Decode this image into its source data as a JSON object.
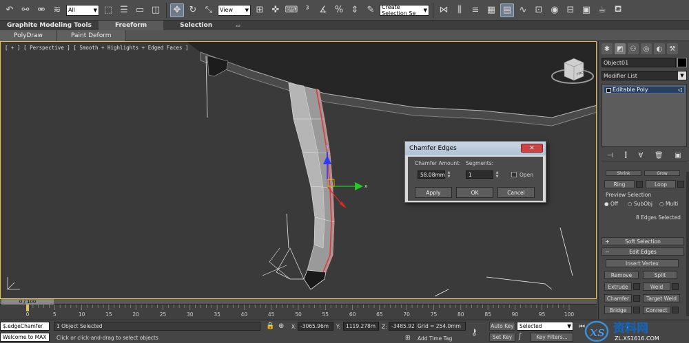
{
  "toolbar": {
    "selection_filter": "All",
    "reference_coord": "View",
    "named_selection_placeholder": "Create Selection Se"
  },
  "ribbon": {
    "tabs": [
      {
        "label": "Graphite Modeling Tools"
      },
      {
        "label": "Freeform"
      },
      {
        "label": "Selection"
      }
    ],
    "panels": [
      {
        "label": "PolyDraw"
      },
      {
        "label": "Paint Deform"
      }
    ]
  },
  "viewport": {
    "label": "[ + ] [ Perspective ] [ Smooth + Highlights + Edged Faces ]",
    "viewcube_label": "FRONT"
  },
  "dialog": {
    "title": "Chamfer Edges",
    "close_label": "✕",
    "chamfer_amount_label": "Chamfer Amount:",
    "chamfer_amount_value": "58.08mm",
    "segments_label": "Segments:",
    "segments_value": "1",
    "open_label": "Open",
    "apply_label": "Apply",
    "ok_label": "OK",
    "cancel_label": "Cancel"
  },
  "command_panel": {
    "object_name": "Object01",
    "modifier_list_label": "Modifier List",
    "stack_item": "Editable Poly",
    "shrink_label": "Shrink",
    "grow_label": "Grow",
    "ring_label": "Ring",
    "loop_label": "Loop",
    "preview_selection_label": "Preview Selection",
    "preview_off_label": "Off",
    "preview_subobj_label": "SubObj",
    "preview_multi_label": "Multi",
    "selection_count": "8 Edges Selected",
    "soft_selection_label": "Soft Selection",
    "edit_edges_label": "Edit Edges",
    "insert_vertex_label": "Insert Vertex",
    "remove_label": "Remove",
    "split_label": "Split",
    "extrude_label": "Extrude",
    "weld_label": "Weld",
    "chamfer_label": "Chamfer",
    "target_weld_label": "Target Weld",
    "bridge_label": "Bridge",
    "connect_label": "Connect"
  },
  "timeline": {
    "frame_display": "0 / 100",
    "frame_position": 0,
    "frame_total": 100,
    "tick_labels": [
      "0",
      "5",
      "10",
      "15",
      "20",
      "25",
      "30",
      "35",
      "40",
      "45",
      "50",
      "55",
      "60",
      "65",
      "70",
      "75",
      "80",
      "85",
      "90",
      "95",
      "100"
    ]
  },
  "status": {
    "maxscript_line1": "$.edgeChamfer",
    "maxscript_line2": "Welcome to MAX",
    "selection_status": "1 Object Selected",
    "prompt": "Click or click-and-drag to select objects",
    "x_label": "X:",
    "x_value": "-3065.96m",
    "y_label": "Y:",
    "y_value": "1119.278m",
    "z_label": "Z:",
    "z_value": "-3485.923",
    "grid": "Grid = 254.0mm",
    "add_time_tag": "Add Time Tag",
    "auto_key": "Auto Key",
    "set_key": "Set Key",
    "key_mode": "Selected",
    "key_filters": "Key Filters..."
  },
  "watermark": {
    "title": "资料网",
    "url": "ZL.XS1616.COM"
  },
  "colors": {
    "viewport_border": "#f0c040",
    "selected_edge": "#e03a3a",
    "dialog_title": "#b2c2d4",
    "close_button": "#c44444"
  }
}
